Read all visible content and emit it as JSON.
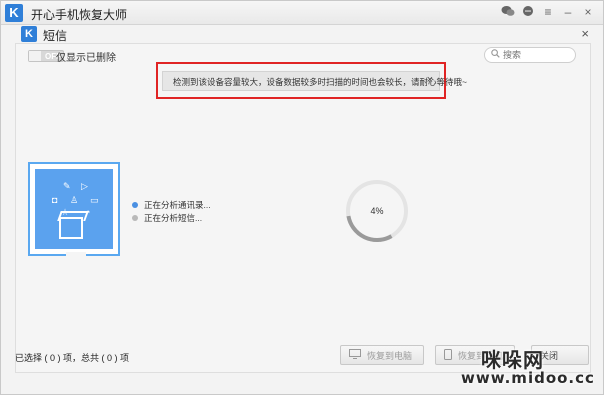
{
  "app": {
    "logo_letter": "K",
    "title": "开心手机恢复大师",
    "titlebar_icons": [
      "wechat-icon",
      "chat-icon",
      "menu-icon",
      "minimize-icon",
      "close-icon"
    ]
  },
  "subheader": {
    "logo_letter": "K",
    "title": "短信",
    "close_glyph": "×"
  },
  "filter": {
    "toggle_state": "OFF",
    "only_deleted_label": "仅显示已删除"
  },
  "search": {
    "placeholder": "搜索"
  },
  "notice": {
    "text": "检测到该设备容量较大，设备数据较多时扫描的时间也会较长，请耐心等待哦~",
    "close_glyph": "×"
  },
  "analysis": {
    "items": [
      {
        "text": "正在分析通讯录...",
        "state": "active",
        "color": "#4a90e2"
      },
      {
        "text": "正在分析短信...",
        "state": "pending",
        "color": "#b9b9b9"
      }
    ],
    "progress_percent": 4,
    "progress_label": "4%"
  },
  "footer": {
    "selection_summary": "已选择 ( 0 ) 项，总共 ( 0 ) 项",
    "recover_pc_label": "恢复到电脑",
    "recover_phone_label": "恢复到手机",
    "close_label": "关闭"
  },
  "watermark": {
    "name": "咪哚网",
    "url": "www.midoo.cc"
  },
  "colors": {
    "accent": "#2f7fd8",
    "device_bg": "#5ba2ee",
    "notice_border": "#e02424"
  }
}
